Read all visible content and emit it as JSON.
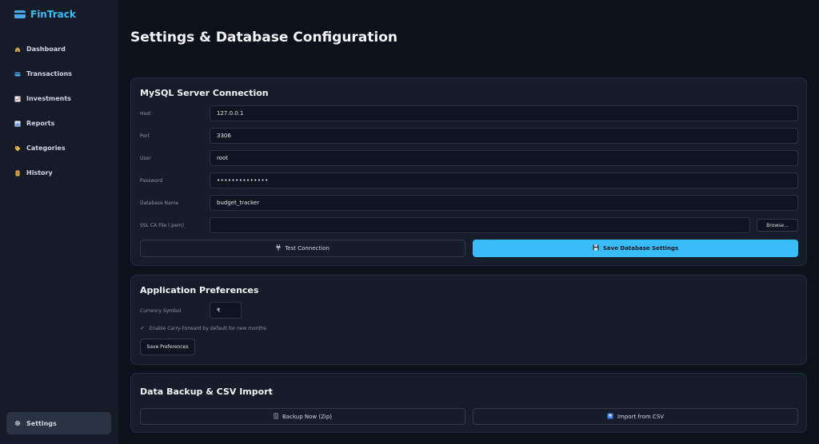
{
  "app": {
    "name": "FinTrack"
  },
  "sidebar": {
    "items": [
      {
        "label": "Dashboard",
        "icon": "house-icon"
      },
      {
        "label": "Transactions",
        "icon": "credit-card-icon"
      },
      {
        "label": "Investments",
        "icon": "chart-icon"
      },
      {
        "label": "Reports",
        "icon": "bar-chart-icon"
      },
      {
        "label": "Categories",
        "icon": "tag-icon"
      },
      {
        "label": "History",
        "icon": "scroll-icon"
      }
    ],
    "settings": {
      "label": "Settings",
      "icon": "gear-icon"
    }
  },
  "page": {
    "title": "Settings & Database Configuration"
  },
  "mysql": {
    "title": "MySQL Server Connection",
    "host": {
      "label": "Host",
      "value": "127.0.0.1"
    },
    "port": {
      "label": "Port",
      "value": "3306"
    },
    "user": {
      "label": "User",
      "value": "root"
    },
    "password": {
      "label": "Password",
      "value": "••••••••••••••"
    },
    "database": {
      "label": "Database Name",
      "value": "budget_tracker"
    },
    "ssl": {
      "label": "SSL CA File (.pem)",
      "value": "",
      "browse_label": "Browse..."
    },
    "test_button": "Test Connection",
    "save_button": "Save Database Settings"
  },
  "preferences": {
    "title": "Application Preferences",
    "currency_label": "Currency Symbol",
    "currency_value": "₹",
    "carry_forward_label": "Enable Carry-Forward by default for new months",
    "carry_forward_checked": true,
    "save_button": "Save Preferences"
  },
  "backup": {
    "title": "Data Backup & CSV Import",
    "backup_button": "Backup Now (Zip)",
    "import_button": "Import from CSV"
  },
  "colors": {
    "accent": "#38bdf8",
    "background": "#0c111c",
    "card": "#161d2a",
    "sidebar": "#151b27",
    "active_nav": "#2a3344"
  }
}
